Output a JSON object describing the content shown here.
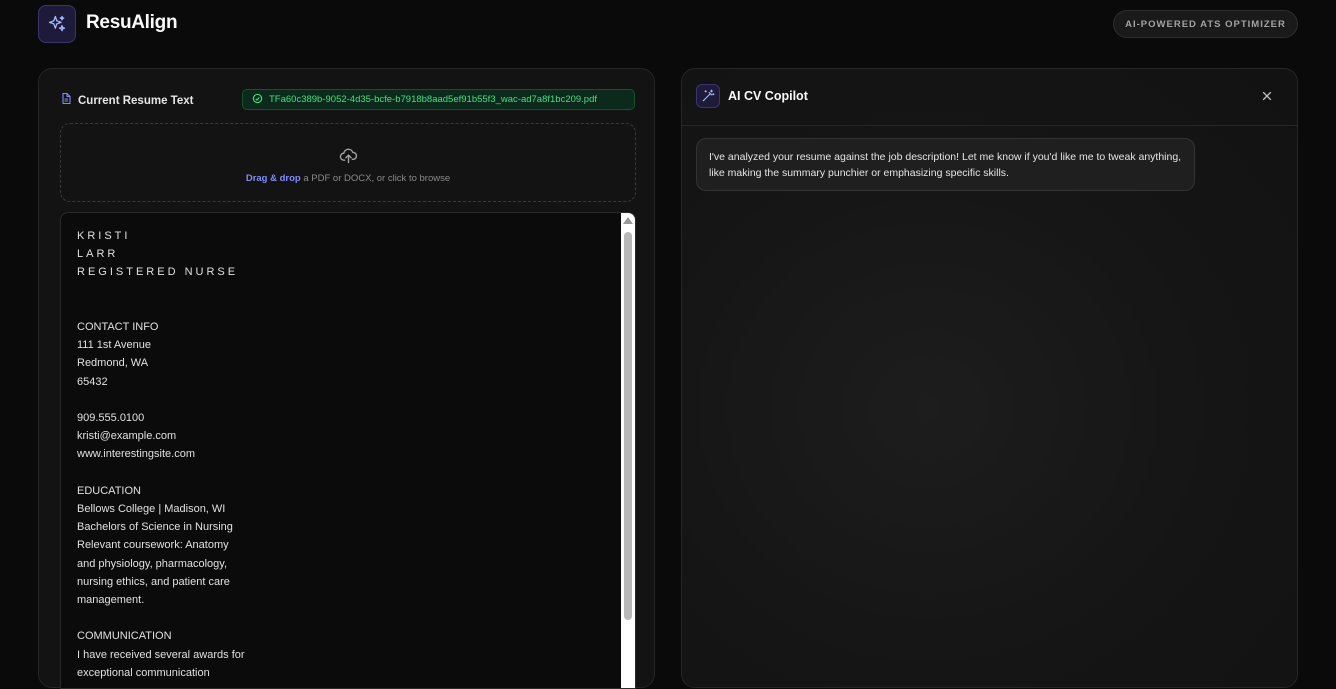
{
  "app": {
    "brand": "ResuAlign",
    "tagline": "AI-POWERED ATS OPTIMIZER"
  },
  "resume_panel": {
    "title": "Current Resume Text",
    "file_name": "TFa60c389b-9052-4d35-bcfe-b7918b8aad5ef91b55f3_wac-ad7a8f1bc209.pdf",
    "dropzone": {
      "link": "Drag & drop",
      "text": " a PDF or DOCX, or click to browse"
    },
    "lines": [
      {
        "text": "KRISTI",
        "spaced": true
      },
      {
        "text": "LARR",
        "spaced": true
      },
      {
        "text": "REGISTERED NURSE",
        "spaced": true
      },
      {
        "text": ""
      },
      {
        "text": ""
      },
      {
        "text": "CONTACT INFO"
      },
      {
        "text": "111 1st Avenue"
      },
      {
        "text": "Redmond, WA"
      },
      {
        "text": "65432"
      },
      {
        "text": ""
      },
      {
        "text": "909.555.0100"
      },
      {
        "text": "kristi@example.com"
      },
      {
        "text": "www.interestingsite.com"
      },
      {
        "text": ""
      },
      {
        "text": "EDUCATION"
      },
      {
        "text": "Bellows College | Madison, WI"
      },
      {
        "text": "Bachelors of Science in Nursing"
      },
      {
        "text": "Relevant coursework: Anatomy"
      },
      {
        "text": "and physiology, pharmacology,"
      },
      {
        "text": "nursing ethics, and patient care"
      },
      {
        "text": "management."
      },
      {
        "text": ""
      },
      {
        "text": "COMMUNICATION"
      },
      {
        "text": "I have received several awards for"
      },
      {
        "text": "exceptional communication"
      }
    ]
  },
  "copilot": {
    "title": "AI CV Copilot",
    "message": "I've analyzed your resume against the job description! Let me know if you'd like me to tweak anything, like making the summary punchier or emphasizing specific skills."
  },
  "icons": {
    "logo": "sparkles-icon",
    "resume_title": "document-icon",
    "file_chip": "check-circle-icon",
    "dropzone": "cloud-upload-icon",
    "copilot": "magic-wand-icon",
    "close": "close-icon"
  },
  "colors": {
    "accent": "#818cf8",
    "success": "#4ade80",
    "background": "#0a0a0a"
  }
}
